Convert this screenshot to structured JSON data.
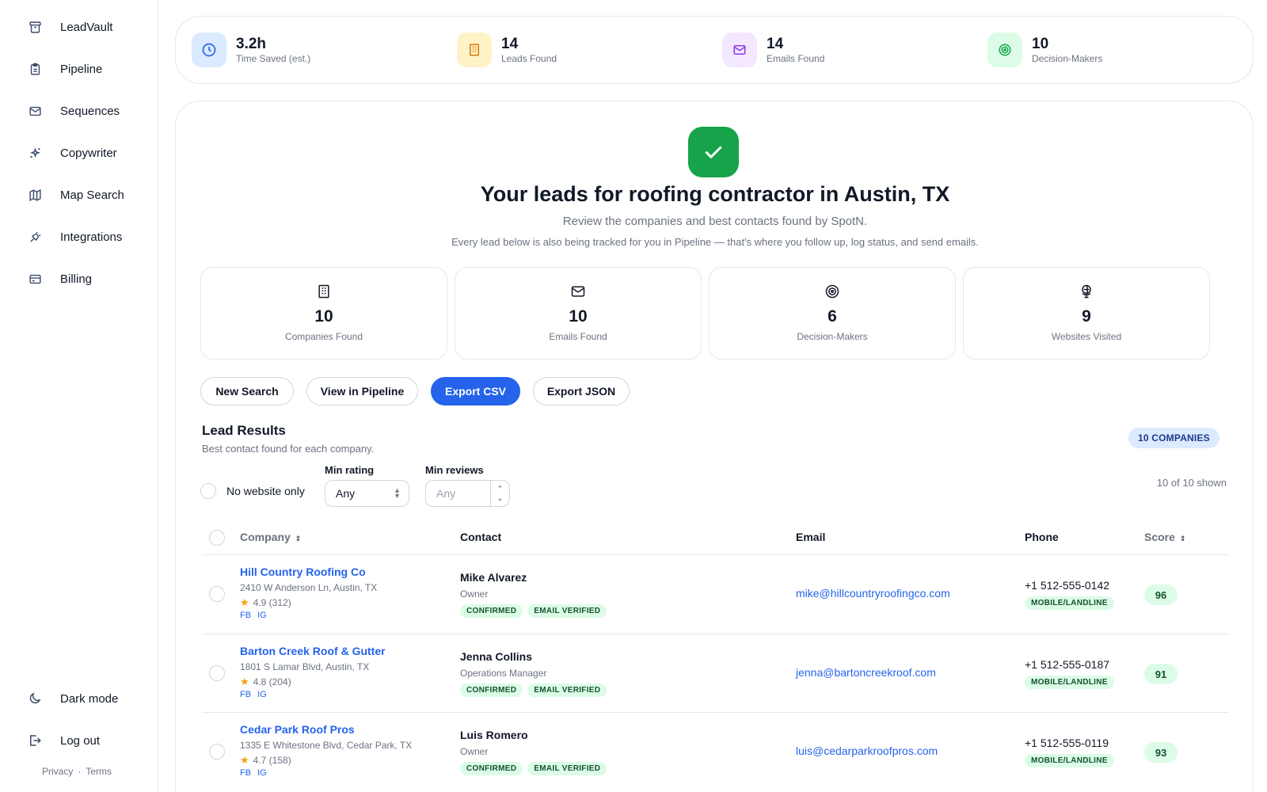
{
  "sidebar": {
    "items": [
      {
        "label": "LeadVault",
        "icon": "archive-icon"
      },
      {
        "label": "Pipeline",
        "icon": "clipboard-icon"
      },
      {
        "label": "Sequences",
        "icon": "mail-icon"
      },
      {
        "label": "Copywriter",
        "icon": "sparkles-icon"
      },
      {
        "label": "Map Search",
        "icon": "map-icon"
      },
      {
        "label": "Integrations",
        "icon": "plug-icon"
      },
      {
        "label": "Billing",
        "icon": "credit-card-icon"
      }
    ],
    "dark_mode": "Dark mode",
    "logout": "Log out",
    "privacy": "Privacy",
    "separator": "·",
    "terms": "Terms"
  },
  "topstats": [
    {
      "value": "3.2h",
      "label": "Time Saved (est.)",
      "icon": "clock-icon",
      "bg": "#dbeafe",
      "fg": "#2563eb"
    },
    {
      "value": "14",
      "label": "Leads Found",
      "icon": "building-icon",
      "bg": "#fef3c7",
      "fg": "#d97706"
    },
    {
      "value": "14",
      "label": "Emails Found",
      "icon": "mail-icon",
      "bg": "#f3e8ff",
      "fg": "#9333ea"
    },
    {
      "value": "10",
      "label": "Decision-Makers",
      "icon": "target-icon",
      "bg": "#dcfce7",
      "fg": "#16a34a"
    }
  ],
  "hero": {
    "title": "Your leads for roofing contractor in Austin, TX",
    "subtitle": "Review the companies and best contacts found by SpotN.",
    "note": "Every lead below is also being tracked for you in Pipeline — that's where you follow up, log status, and send emails."
  },
  "kpis": [
    {
      "value": "10",
      "label": "Companies Found",
      "icon": "building-icon"
    },
    {
      "value": "10",
      "label": "Emails Found",
      "icon": "mail-icon"
    },
    {
      "value": "6",
      "label": "Decision-Makers",
      "icon": "target-icon"
    },
    {
      "value": "9",
      "label": "Websites Visited",
      "icon": "globe-icon"
    }
  ],
  "actions": {
    "new_search": "New Search",
    "view_pipeline": "View in Pipeline",
    "export_csv": "Export CSV",
    "export_json": "Export JSON"
  },
  "results": {
    "title": "Lead Results",
    "subtitle": "Best contact found for each company.",
    "badge": "10 COMPANIES",
    "shown": "10 of 10 shown"
  },
  "filters": {
    "no_website": "No website only",
    "min_rating_label": "Min rating",
    "min_rating_value": "Any",
    "min_reviews_label": "Min reviews",
    "min_reviews_placeholder": "Any"
  },
  "table": {
    "headers": {
      "company": "Company",
      "contact": "Contact",
      "email": "Email",
      "phone": "Phone",
      "score": "Score"
    },
    "rows": [
      {
        "company": "Hill Country Roofing Co",
        "address": "2410 W Anderson Ln, Austin, TX",
        "rating": "4.9 (312)",
        "social1": "FB",
        "social2": "IG",
        "contact": "Mike Alvarez",
        "role": "Owner",
        "tag1": "CONFIRMED",
        "tag2": "EMAIL VERIFIED",
        "email": "mike@hillcountryroofingco.com",
        "phone": "+1 512-555-0142",
        "phone_tag": "MOBILE/LANDLINE",
        "score": "96"
      },
      {
        "company": "Barton Creek Roof & Gutter",
        "address": "1801 S Lamar Blvd, Austin, TX",
        "rating": "4.8 (204)",
        "social1": "FB",
        "social2": "IG",
        "contact": "Jenna Collins",
        "role": "Operations Manager",
        "tag1": "CONFIRMED",
        "tag2": "EMAIL VERIFIED",
        "email": "jenna@bartoncreekroof.com",
        "phone": "+1 512-555-0187",
        "phone_tag": "MOBILE/LANDLINE",
        "score": "91"
      },
      {
        "company": "Cedar Park Roof Pros",
        "address": "1335 E Whitestone Blvd, Cedar Park, TX",
        "rating": "4.7 (158)",
        "social1": "FB",
        "social2": "IG",
        "contact": "Luis Romero",
        "role": "Owner",
        "tag1": "CONFIRMED",
        "tag2": "EMAIL VERIFIED",
        "email": "luis@cedarparkroofpros.com",
        "phone": "+1 512-555-0119",
        "phone_tag": "MOBILE/LANDLINE",
        "score": "93"
      }
    ]
  }
}
